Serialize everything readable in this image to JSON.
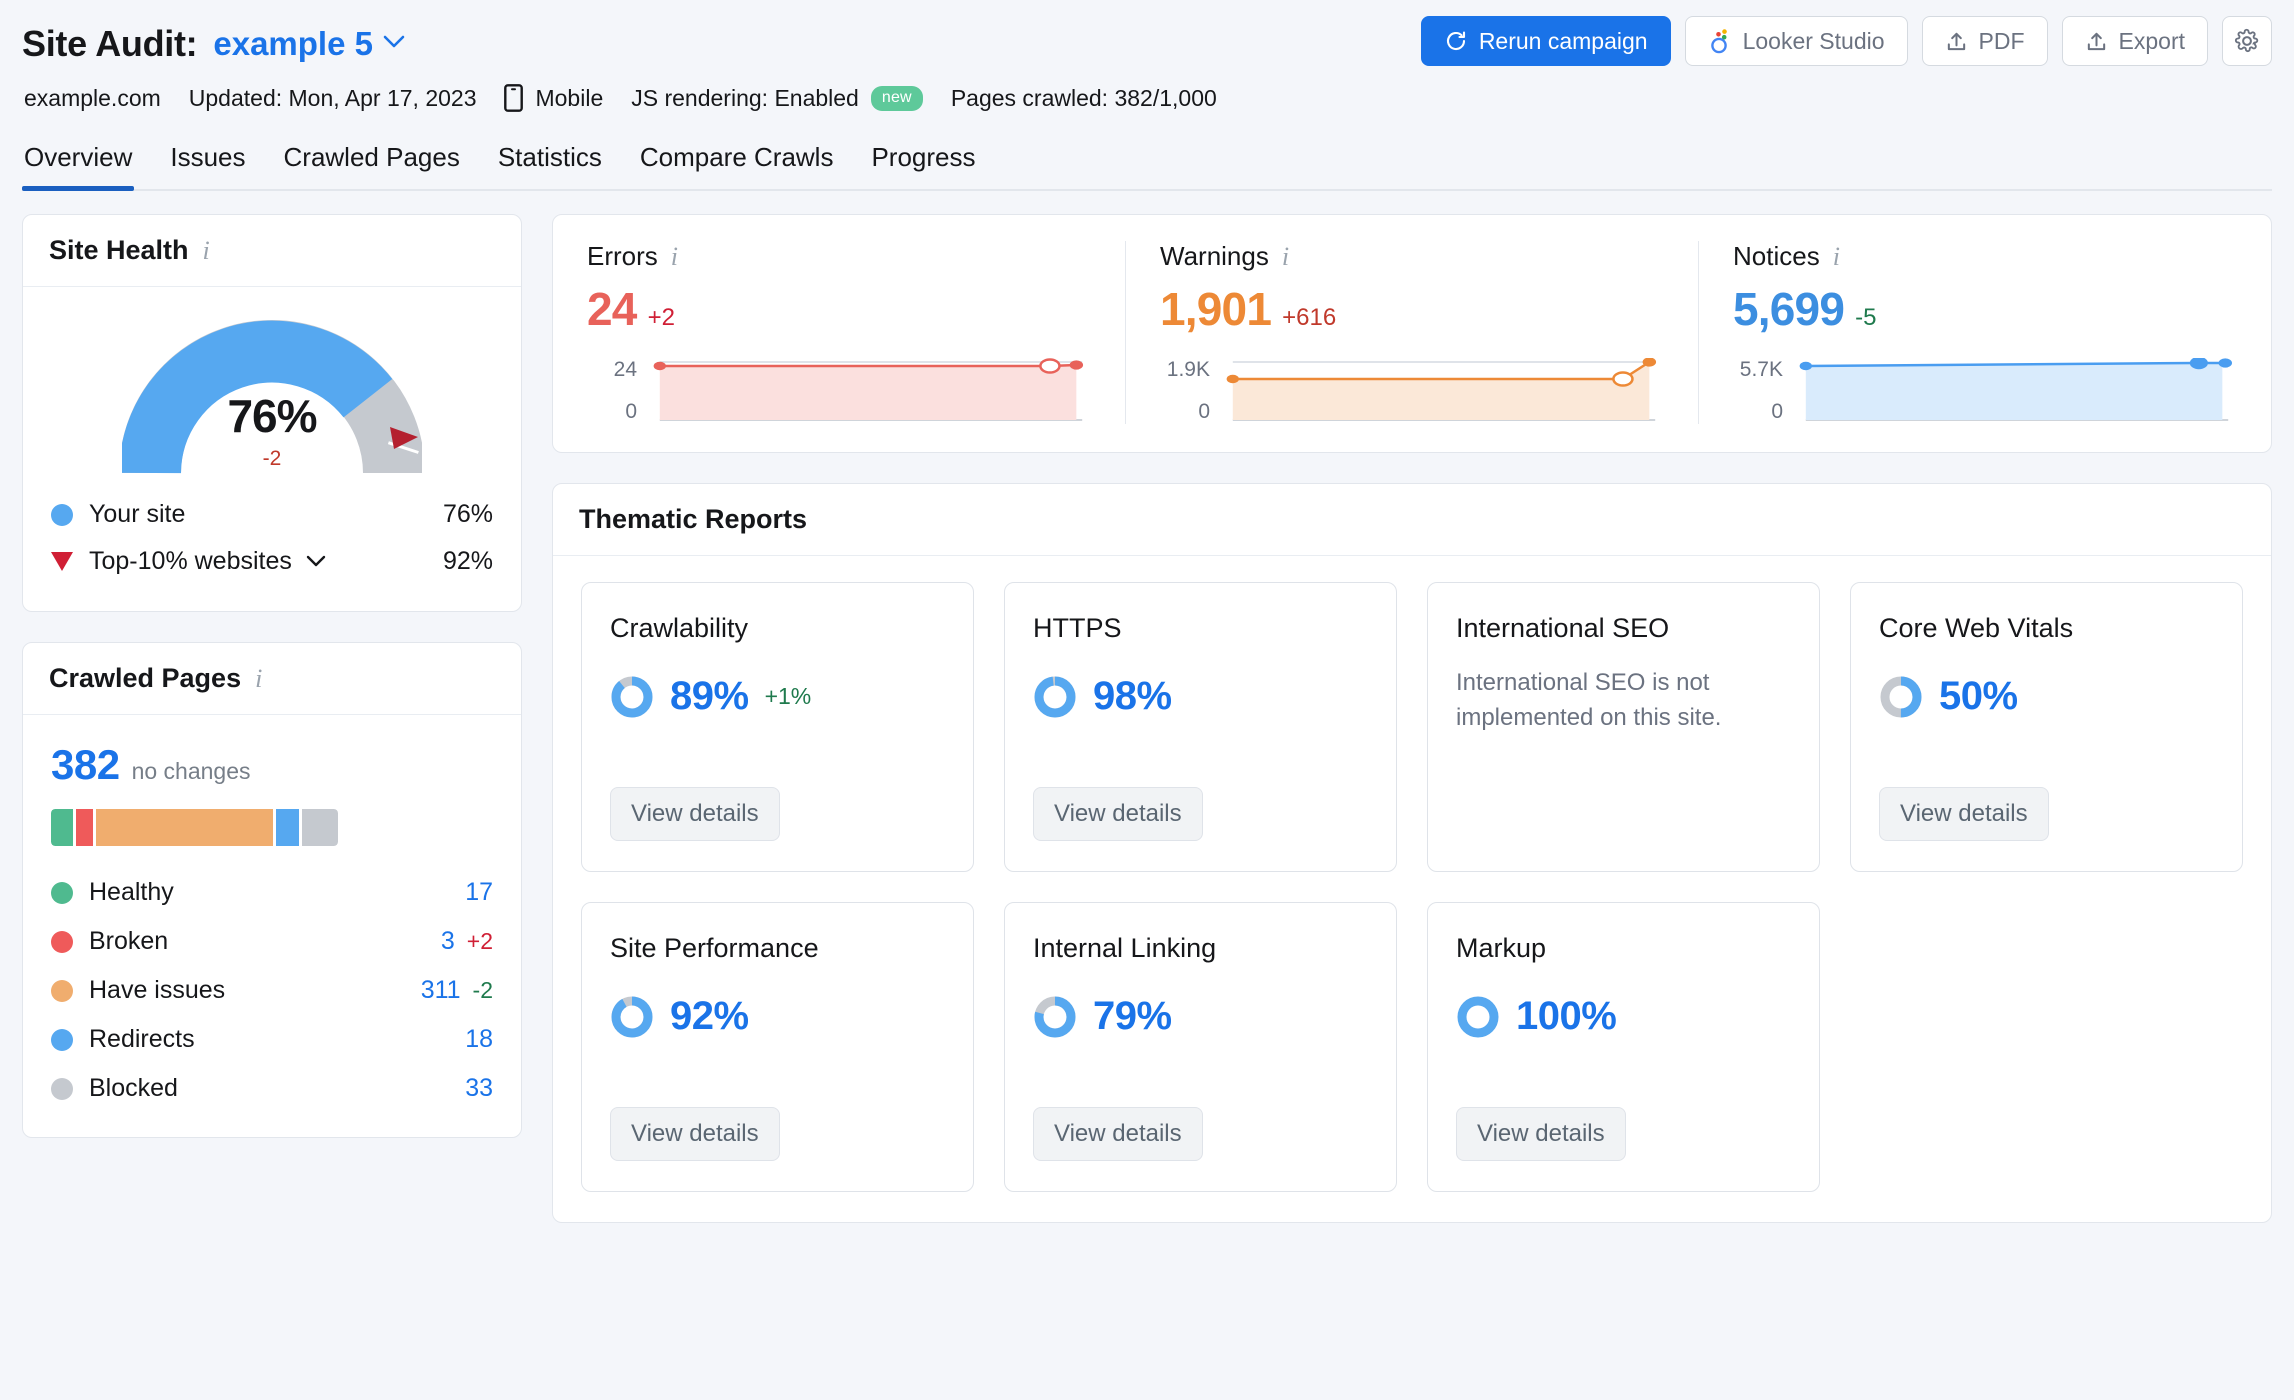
{
  "header": {
    "title": "Site Audit:",
    "campaign": "example 5",
    "caret": "chevron-down",
    "meta": {
      "domain": "example.com",
      "updated": "Updated: Mon, Apr 17, 2023",
      "device": "Mobile",
      "js_rendering": "JS rendering: Enabled",
      "new_badge": "new",
      "pages_crawled": "Pages crawled: 382/1,000"
    },
    "actions": {
      "rerun": "Rerun campaign",
      "looker": "Looker Studio",
      "pdf": "PDF",
      "export": "Export",
      "settings": "settings"
    }
  },
  "tabs": [
    {
      "label": "Overview",
      "active": true
    },
    {
      "label": "Issues",
      "active": false
    },
    {
      "label": "Crawled Pages",
      "active": false
    },
    {
      "label": "Statistics",
      "active": false
    },
    {
      "label": "Compare Crawls",
      "active": false
    },
    {
      "label": "Progress",
      "active": false
    }
  ],
  "site_health": {
    "title": "Site Health",
    "value": "76%",
    "delta": "-2",
    "legend": [
      {
        "label": "Your site",
        "value": "76%",
        "marker": "dot",
        "color": "#56a8f0"
      },
      {
        "label": "Top-10% websites",
        "value": "92%",
        "marker": "triangle",
        "color": "#d01f35"
      }
    ]
  },
  "crawled_pages": {
    "title": "Crawled Pages",
    "total": "382",
    "change": "no changes",
    "rows": [
      {
        "label": "Healthy",
        "count": "17",
        "delta": "",
        "delta_dir": "none",
        "color": "#4fba8f"
      },
      {
        "label": "Broken",
        "count": "3",
        "delta": "+2",
        "delta_dir": "up",
        "color": "#ef5a5a"
      },
      {
        "label": "Have issues",
        "count": "311",
        "delta": "-2",
        "delta_dir": "down",
        "color": "#f0ad6e"
      },
      {
        "label": "Redirects",
        "count": "18",
        "delta": "",
        "delta_dir": "none",
        "color": "#56a8f0"
      },
      {
        "label": "Blocked",
        "count": "33",
        "delta": "",
        "delta_dir": "none",
        "color": "#c5c9cf"
      }
    ]
  },
  "stats": [
    {
      "name": "Errors",
      "value": "24",
      "delta": "+2",
      "color": "#e8625a",
      "fill": "#fbe0de",
      "axis_top": "24",
      "axis_bottom": "0"
    },
    {
      "name": "Warnings",
      "value": "1,901",
      "delta": "+616",
      "color": "#ed8936",
      "fill": "#fbe8d8",
      "axis_top": "1.9K",
      "axis_bottom": "0"
    },
    {
      "name": "Notices",
      "value": "5,699",
      "delta": "-5",
      "color": "#4a9df0",
      "fill": "#d9ebfc",
      "axis_top": "5.7K",
      "axis_bottom": "0"
    }
  ],
  "thematic": {
    "title": "Thematic Reports",
    "button_label": "View details",
    "cards": [
      {
        "name": "Crawlability",
        "pct": "89%",
        "value": 89,
        "delta": "+1%",
        "empty": "",
        "has_button": true
      },
      {
        "name": "HTTPS",
        "pct": "98%",
        "value": 98,
        "delta": "",
        "empty": "",
        "has_button": true
      },
      {
        "name": "International SEO",
        "pct": "",
        "value": 0,
        "delta": "",
        "empty": "International SEO is not implemented on this site.",
        "has_button": false
      },
      {
        "name": "Core Web Vitals",
        "pct": "50%",
        "value": 50,
        "delta": "",
        "empty": "",
        "has_button": true
      },
      {
        "name": "Site Performance",
        "pct": "92%",
        "value": 92,
        "delta": "",
        "empty": "",
        "has_button": true
      },
      {
        "name": "Internal Linking",
        "pct": "79%",
        "value": 79,
        "delta": "",
        "empty": "",
        "has_button": true
      },
      {
        "name": "Markup",
        "pct": "100%",
        "value": 100,
        "delta": "",
        "empty": "",
        "has_button": true
      }
    ]
  },
  "chart_data": [
    {
      "type": "area",
      "title": "Errors",
      "x": [
        0,
        1,
        2,
        3
      ],
      "values": [
        24,
        24,
        24,
        24
      ],
      "ylim": [
        0,
        24
      ],
      "ylabel": "",
      "tick_labels": [
        "24",
        "0"
      ],
      "color": "#e8625a"
    },
    {
      "type": "area",
      "title": "Warnings",
      "x": [
        0,
        1,
        2,
        3
      ],
      "values": [
        1285,
        1285,
        1285,
        1901
      ],
      "ylim": [
        0,
        1901
      ],
      "ylabel": "",
      "tick_labels": [
        "1.9K",
        "0"
      ],
      "color": "#ed8936"
    },
    {
      "type": "area",
      "title": "Notices",
      "x": [
        0,
        1,
        2,
        3
      ],
      "values": [
        5694,
        5699,
        5699,
        5699
      ],
      "ylim": [
        0,
        5700
      ],
      "ylabel": "",
      "tick_labels": [
        "5.7K",
        "0"
      ],
      "color": "#4a9df0"
    },
    {
      "type": "pie",
      "title": "Site Health",
      "categories": [
        "Your site",
        "Remaining"
      ],
      "values": [
        76,
        24
      ],
      "benchmark": 92,
      "colors": [
        "#56a8f0",
        "#c5c9cf"
      ]
    },
    {
      "type": "bar",
      "title": "Crawled Pages breakdown",
      "categories": [
        "Healthy",
        "Broken",
        "Have issues",
        "Redirects",
        "Blocked"
      ],
      "values": [
        17,
        3,
        311,
        18,
        33
      ],
      "total": 382,
      "colors": [
        "#4fba8f",
        "#ef5a5a",
        "#f0ad6e",
        "#56a8f0",
        "#c5c9cf"
      ]
    }
  ]
}
